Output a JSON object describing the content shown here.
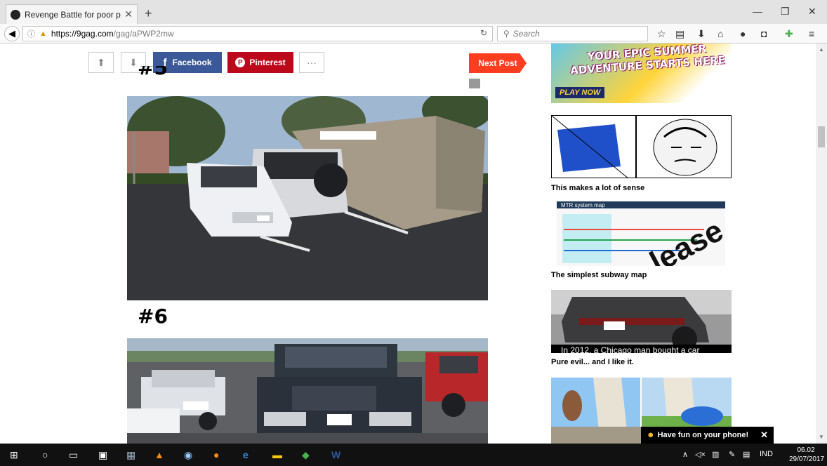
{
  "browser": {
    "tab_title": "Revenge Battle for poor p...",
    "new_tab": "+",
    "url_host": "https://9gag.com",
    "url_path": "/gag/aPWP2mw",
    "search_placeholder": "Search",
    "window_controls": [
      "minimize-icon",
      "restore-icon",
      "close-icon"
    ]
  },
  "post": {
    "share_facebook": "Facebook",
    "share_pinterest": "Pinterest",
    "more": "···",
    "next_post": "Next Post",
    "heading_5": "#5",
    "heading_6": "#6"
  },
  "sidebar": {
    "ad_text": "YOUR EPIC SUMMER ADVENTURE STARTS HERE",
    "ad_cta": "PLAY NOW",
    "items": [
      {
        "caption": "This makes a lot of sense"
      },
      {
        "caption": "The simplest subway map",
        "overlay": "MTR system map"
      },
      {
        "caption": "Pure evil... and I like it.",
        "overlay": "In 2012, a Chicago man bought a car"
      }
    ]
  },
  "toast": {
    "text": "Have fun on your phone!",
    "close": "✕"
  },
  "taskbar": {
    "lang": "IND",
    "time": "06.02",
    "date": "29/07/2017"
  },
  "colors": {
    "facebook": "#3b5998",
    "pinterest": "#bd081c",
    "next": "#ff3d1f"
  }
}
